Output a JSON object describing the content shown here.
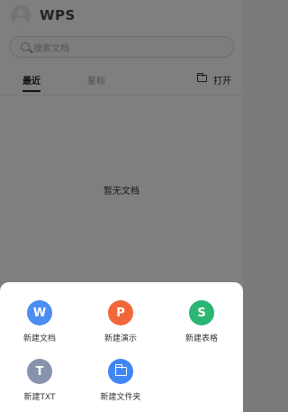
{
  "app": {
    "logo_text": "WPS",
    "search": {
      "placeholder": "搜索文档"
    },
    "tabs": [
      {
        "label": "最近",
        "selected": true
      },
      {
        "label": "星标",
        "selected": false
      }
    ],
    "open_label": "打开",
    "empty_message": "暂无文档"
  },
  "sheet": {
    "actions": [
      {
        "label": "新建文档",
        "glyph": "W",
        "icon": "doc-w-icon",
        "color": "#4b8df0"
      },
      {
        "label": "新建演示",
        "glyph": "P",
        "icon": "presentation-p-icon",
        "color": "#f2673a"
      },
      {
        "label": "新建表格",
        "glyph": "S",
        "icon": "spreadsheet-s-icon",
        "color": "#2bb673"
      },
      {
        "label": "新建TXT",
        "glyph": "T",
        "icon": "text-t-icon",
        "color": "#8792ab"
      },
      {
        "label": "新建文件夹",
        "glyph": "",
        "icon": "folder-icon",
        "color": "#3f86f5"
      }
    ]
  }
}
